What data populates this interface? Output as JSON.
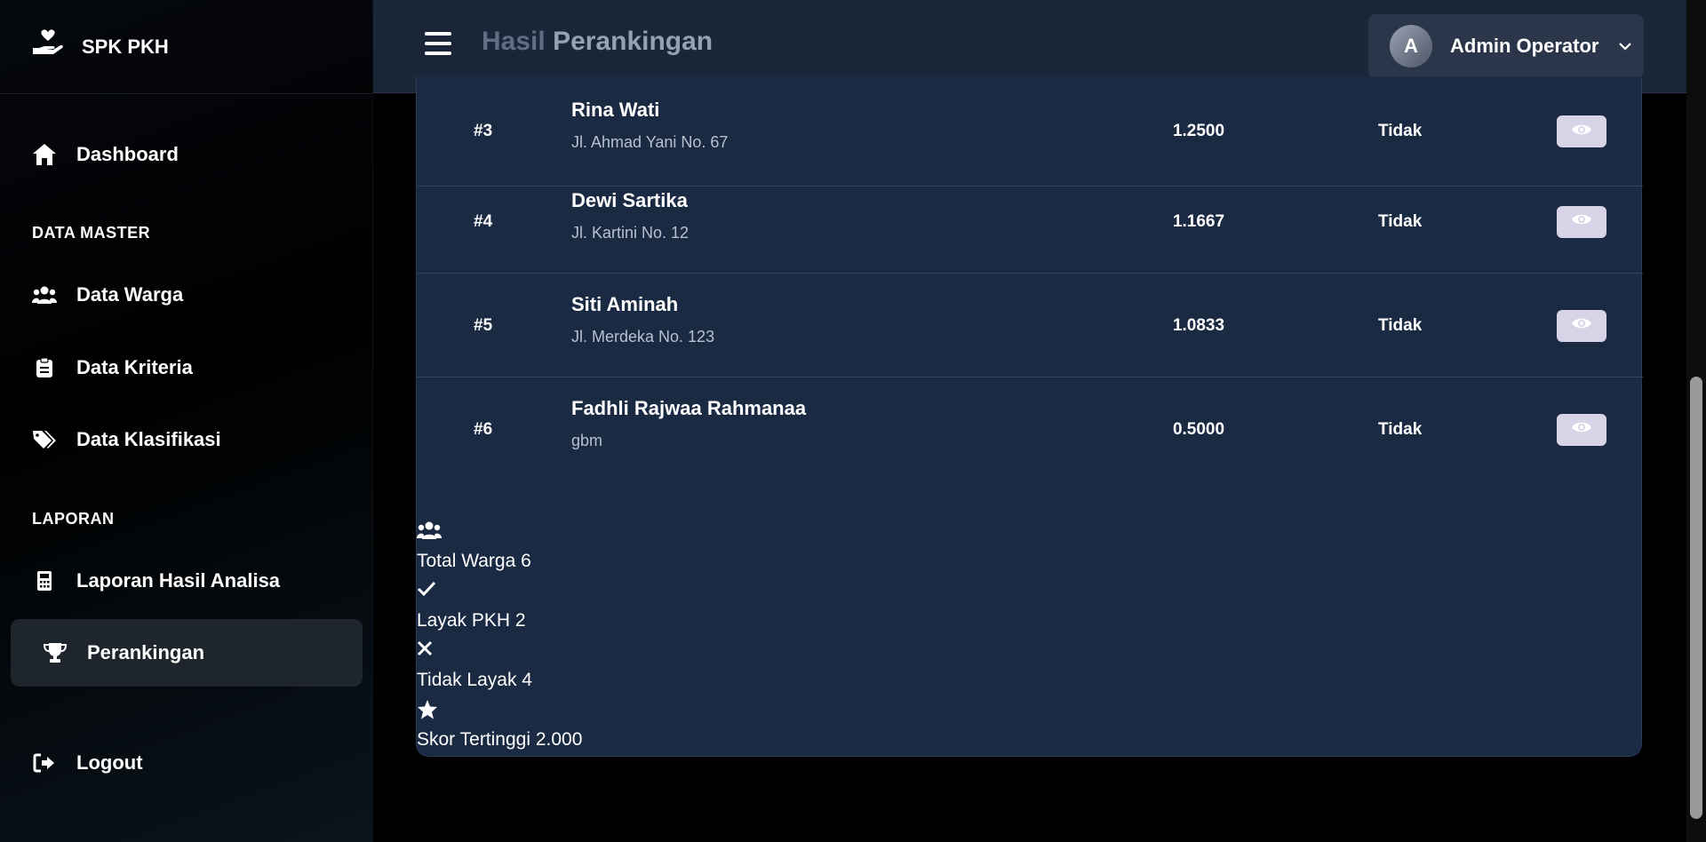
{
  "brand": {
    "name": "SPK PKH",
    "icon": "hand-heart-icon"
  },
  "sidebar": {
    "items": [
      {
        "label": "Dashboard",
        "icon": "home-icon"
      },
      {
        "label": "Data Warga",
        "icon": "users-icon"
      },
      {
        "label": "Data Kriteria",
        "icon": "clipboard-icon"
      },
      {
        "label": "Data Klasifikasi",
        "icon": "tags-icon"
      },
      {
        "label": "Laporan Hasil Analisa",
        "icon": "calculator-icon"
      },
      {
        "label": "Perankingan",
        "icon": "trophy-icon",
        "active": true
      },
      {
        "label": "Logout",
        "icon": "logout-icon"
      }
    ],
    "sections": {
      "master": "DATA MASTER",
      "laporan": "LAPORAN"
    }
  },
  "header": {
    "title_part1": "Hasil",
    "title_part2": "Perankingan",
    "user_initial": "A",
    "user_name": "Admin Operator"
  },
  "ranking": {
    "rows": [
      {
        "rank": "#3",
        "name": "Rina Wati",
        "address": "Jl. Ahmad Yani No. 67",
        "score": "1.2500",
        "status": "Tidak"
      },
      {
        "rank": "#4",
        "name": "Dewi Sartika",
        "address": "Jl. Kartini No. 12",
        "score": "1.1667",
        "status": "Tidak"
      },
      {
        "rank": "#5",
        "name": "Siti Aminah",
        "address": "Jl. Merdeka No. 123",
        "score": "1.0833",
        "status": "Tidak"
      },
      {
        "rank": "#6",
        "name": "Fadhli Rajwaa Rahmanaa",
        "address": "gbm",
        "score": "0.5000",
        "status": "Tidak"
      }
    ]
  },
  "stats": [
    {
      "label": "Total Warga 6",
      "icon": "users-icon"
    },
    {
      "label": "Layak PKH 2",
      "icon": "check-icon"
    },
    {
      "label": "Tidak Layak 4",
      "icon": "close-icon"
    },
    {
      "label": "Skor Tertinggi 2.000",
      "icon": "star-icon"
    }
  ],
  "colors": {
    "card_bg": "#1b2a43",
    "header_bg": "#1b2538",
    "eye_button_bg": "#d8d3e6"
  }
}
